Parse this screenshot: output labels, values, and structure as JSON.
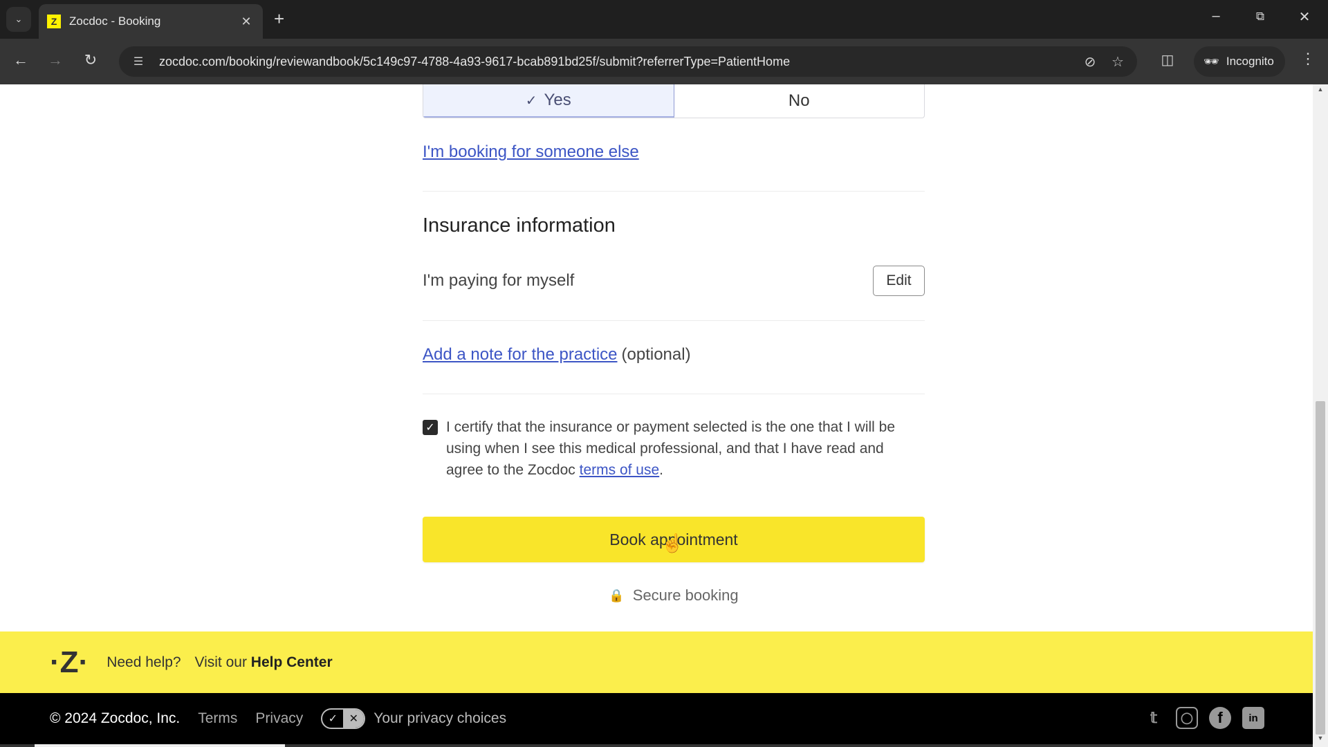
{
  "browser": {
    "tab_title": "Zocdoc - Booking",
    "tab_favicon": "Z",
    "url": "zocdoc.com/booking/reviewandbook/5c149c97-4788-4a93-9617-bcab891bd25f/submit?referrerType=PatientHome",
    "incognito_label": "Incognito"
  },
  "booking_for_self": {
    "options": [
      {
        "label": "Yes",
        "selected": true
      },
      {
        "label": "No",
        "selected": false
      }
    ],
    "someone_else_link": "I'm booking for someone else"
  },
  "insurance": {
    "title": "Insurance information",
    "value": "I'm paying for myself",
    "edit_label": "Edit"
  },
  "note": {
    "link": "Add a note for the practice",
    "suffix": "(optional)"
  },
  "certify": {
    "checked": true,
    "text_before": "I certify that the insurance or payment selected is the one that I will be using when I see this medical professional, and that I have read and agree to the Zocdoc ",
    "link": "terms of use",
    "text_after": "."
  },
  "book_button": "Book appointment",
  "secure_label": "Secure booking",
  "help_bar": {
    "need_help": "Need help?",
    "visit": "Visit our",
    "help_center": "Help Center"
  },
  "legal_bar": {
    "copyright": "© 2024 Zocdoc, Inc.",
    "terms": "Terms",
    "privacy": "Privacy",
    "privacy_choices": "Your privacy choices",
    "socials": [
      "twitter",
      "instagram",
      "facebook",
      "linkedin"
    ]
  },
  "colors": {
    "brand_yellow": "#f9e52a",
    "help_bar_yellow": "#fbee4c",
    "link_blue": "#3c55c5",
    "selected_bg": "#eef2fd"
  }
}
